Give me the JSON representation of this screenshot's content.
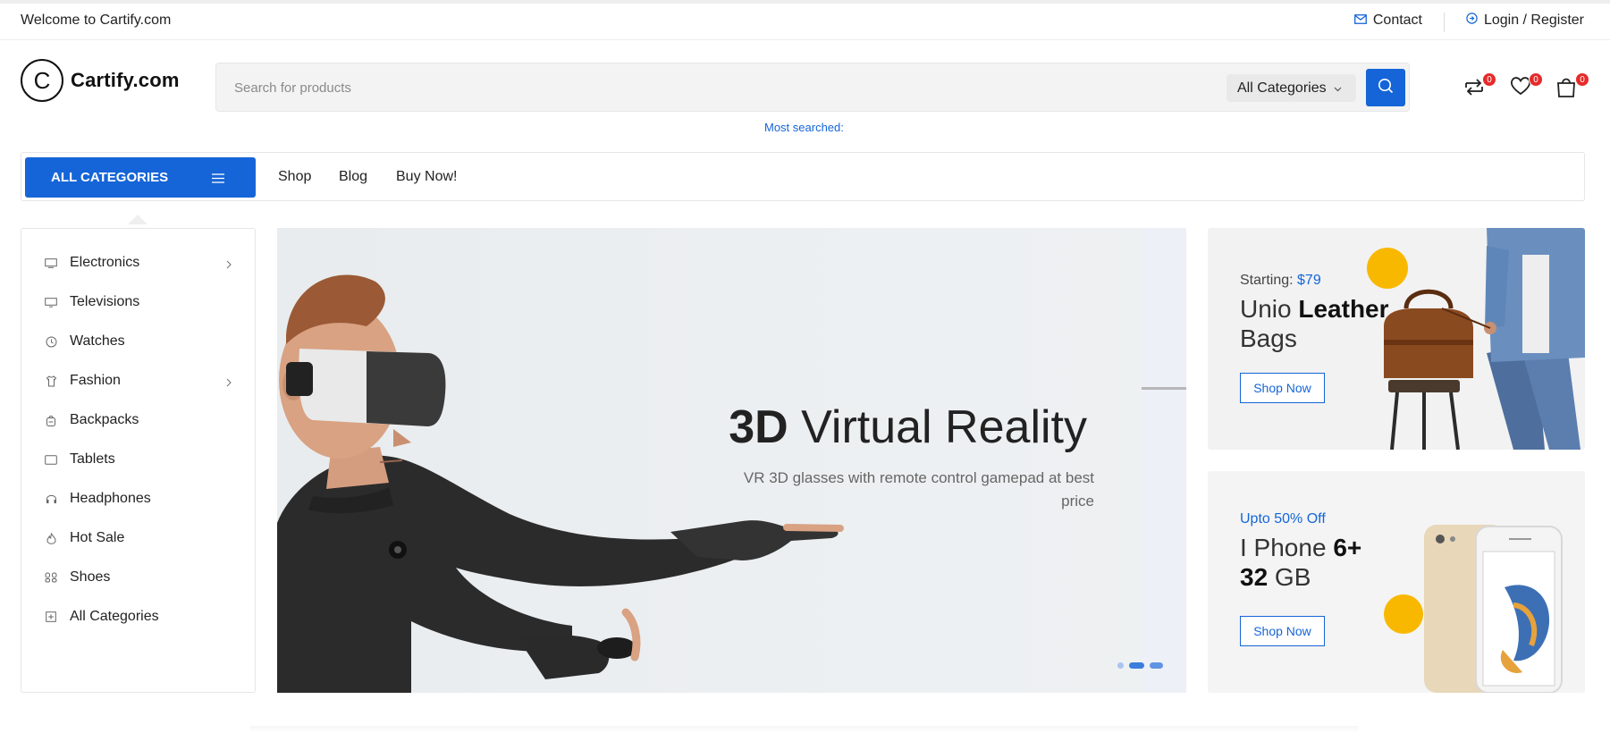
{
  "topbar": {
    "welcome": "Welcome to Cartify.com",
    "contact": "Contact",
    "login": "Login / Register"
  },
  "header": {
    "logo_letter": "C",
    "logo_text": "Cartify.com",
    "search_placeholder": "Search for products",
    "category_select": "All Categories",
    "most_searched": "Most searched:",
    "compare_count": "0",
    "wishlist_count": "0",
    "cart_count": "0"
  },
  "nav": {
    "all_categories": "ALL CATEGORIES",
    "links": [
      "Shop",
      "Blog",
      "Buy Now!"
    ]
  },
  "sidebar": {
    "items": [
      {
        "label": "Electronics",
        "icon": "monitor-icon",
        "has_submenu": true
      },
      {
        "label": "Televisions",
        "icon": "tv-icon",
        "has_submenu": false
      },
      {
        "label": "Watches",
        "icon": "clock-icon",
        "has_submenu": false
      },
      {
        "label": "Fashion",
        "icon": "shirt-icon",
        "has_submenu": true
      },
      {
        "label": "Backpacks",
        "icon": "backpack-icon",
        "has_submenu": false
      },
      {
        "label": "Tablets",
        "icon": "tablet-icon",
        "has_submenu": false
      },
      {
        "label": "Headphones",
        "icon": "headphones-icon",
        "has_submenu": false
      },
      {
        "label": "Hot Sale",
        "icon": "flame-icon",
        "has_submenu": false
      },
      {
        "label": "Shoes",
        "icon": "shoes-icon",
        "has_submenu": false
      },
      {
        "label": "All Categories",
        "icon": "plus-box-icon",
        "has_submenu": false
      }
    ]
  },
  "hero": {
    "title_bold": "3D",
    "title_rest": " Virtual Reality",
    "subtitle": "VR 3D glasses with remote control gamepad at best price",
    "slides": 3,
    "active_slide": 2
  },
  "promos": [
    {
      "pre": "Starting: ",
      "pre_accent": "$79",
      "title_light": "Unio ",
      "title_bold": "Leather",
      "title_tail": " Bags",
      "button": "Shop Now"
    },
    {
      "pre": "Upto 50% Off",
      "title_light": "I Phone ",
      "title_bold": "6+",
      "title_bold2": "32",
      "title_tail": " GB",
      "button": "Shop Now"
    }
  ],
  "colors": {
    "primary": "#1565d8",
    "badge": "#e52b2b",
    "accent_yellow": "#f9b800"
  }
}
